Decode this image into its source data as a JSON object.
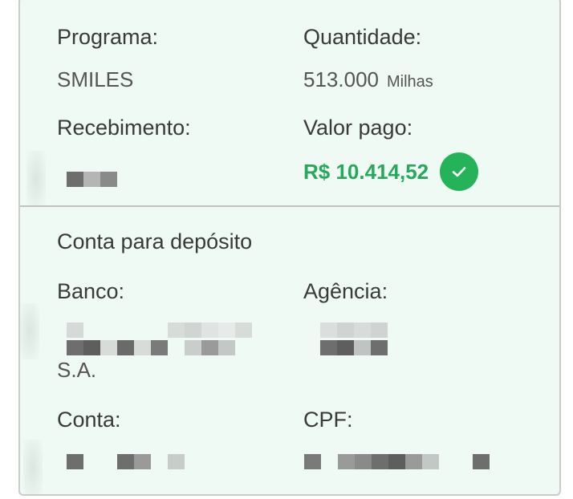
{
  "program": {
    "label": "Programa:",
    "value": "SMILES"
  },
  "quantity": {
    "label": "Quantidade:",
    "value": "513.000",
    "unit": "Milhas"
  },
  "receipt": {
    "label": "Recebimento:"
  },
  "amount_paid": {
    "label": "Valor pago:",
    "value": "R$ 10.414,52",
    "status_icon": "check-circle-icon",
    "status_color": "#25b35a"
  },
  "deposit": {
    "title": "Conta para depósito",
    "bank_label": "Banco:",
    "bank_suffix": "S.A.",
    "agency_label": "Agência:",
    "account_label": "Conta:",
    "cpf_label": "CPF:"
  },
  "colors": {
    "card_background": "#eefaf3",
    "amount_green": "#27a85a"
  }
}
